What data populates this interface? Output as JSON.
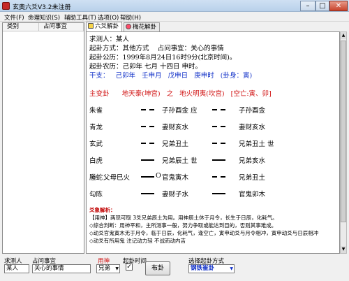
{
  "window": {
    "title": "玄奥六爻V3.2未注册",
    "min": "–",
    "max": "□",
    "close": "✕"
  },
  "menu": [
    "文件(F)",
    "命理知识(S)",
    "辅助工具(T)",
    "选项(O)",
    "帮助(H)"
  ],
  "left_panel": {
    "columns": [
      "类别",
      "占问事宜"
    ]
  },
  "tabs": [
    {
      "label": "六爻解卦",
      "active": true
    },
    {
      "label": "梅花解卦",
      "active": false
    }
  ],
  "content": {
    "header": [
      "求测人：某人",
      "起卦方式：其他方式    占问事宜：关心的事情",
      "起卦公历：1999年8月24日16时9分(北京时间)。",
      "起卦农历：己卯年 七月 十四日 申时。"
    ],
    "ganzhi": "干支：   己卯年   壬申月   戊申日   庚申时   (卦身：寅)",
    "gua_title": "主变卦      地天泰(坤宫)   之   地火明夷(坎宫)   [空亡:寅、卯]",
    "rows": [
      {
        "god": "朱雀",
        "fu": "",
        "main": "子孙酉金 应",
        "change": "子孙酉金",
        "main_yin": true,
        "change_yin": true,
        "marker": ""
      },
      {
        "god": "青龙",
        "fu": "",
        "main": "妻财亥水",
        "change": "妻财亥水",
        "main_yin": true,
        "change_yin": true,
        "marker": ""
      },
      {
        "god": "玄武",
        "fu": "",
        "main": "兄弟丑土",
        "change": "兄弟丑土 世",
        "main_yin": true,
        "change_yin": true,
        "marker": ""
      },
      {
        "god": "白虎",
        "fu": "",
        "main": "兄弟辰土 世",
        "change": "兄弟亥水",
        "main_yin": false,
        "change_yin": false,
        "marker": ""
      },
      {
        "god": "螣蛇",
        "fu": "父母巳火",
        "main": "官鬼寅木",
        "change": "兄弟丑土",
        "main_yin": false,
        "change_yin": true,
        "marker": "O"
      },
      {
        "god": "勾陈",
        "fu": "",
        "main": "妻财子水",
        "change": "官鬼卯木",
        "main_yin": false,
        "change_yin": false,
        "marker": ""
      }
    ],
    "analysis_title": "爻象解析：",
    "analysis_lines": [
      "【用神】两现可取 3爻兄弟辰土为用。用神辰土休于月令，长生于日辰，化耗气。",
      "◇综合判断：用神平和，主所测事一般，努力争取或能达到目的，否则其事难成。",
      "◇动爻官鬼寅木无于月令，临于日辰，化耗气，逢空亡，寅申动爻与月令相冲，寅申动爻与日辰相冲",
      "◇动爻有所用鬼   注记动力轻   不战而动内吉"
    ]
  },
  "bottom": {
    "labels": {
      "seeker": "求测人",
      "matter": "占问事宜",
      "yongshen": "用神",
      "time": "起卦时间",
      "method": "选择起卦方式"
    },
    "seeker_value": "某人",
    "matter_value": "关心的事情",
    "yongshen_value": "兄弟",
    "method_value": "钢铁崔卦",
    "button": "布卦",
    "checkbox_checked": true
  }
}
